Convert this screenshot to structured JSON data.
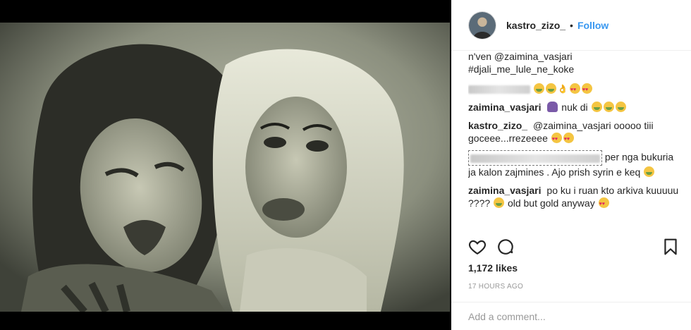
{
  "post": {
    "username": "kastro_zizo_",
    "separator": "•",
    "follow_label": "Follow",
    "caption_lines": [
      "n'ven @zaimina_vasjari",
      "#djali_me_lule_ne_koke"
    ],
    "comments": [
      {
        "user": "zaimina_vasjari",
        "text": "nuk di"
      },
      {
        "user": "kastro_zizo_",
        "text": "@zaimina_vasjari ooooo tiii goceee...rrezeeee"
      },
      {
        "text_lines": [
          "per nga",
          "bukuria ja kalon zajmines . Ajo prish syrin e",
          "keq"
        ]
      },
      {
        "user": "zaimina_vasjari",
        "text_lines": [
          "po ku i ruan kto arkiva",
          "kuuuuu ????",
          "old but gold anyway"
        ]
      }
    ],
    "likes": "1,172 likes",
    "time": "17 HOURS AGO",
    "add_comment_placeholder": "Add a comment..."
  },
  "icons": {
    "like": "heart-icon",
    "comment": "comment-bubble-icon",
    "save": "bookmark-icon"
  },
  "colors": {
    "accent": "#3897f0",
    "text": "#262626",
    "muted": "#999999"
  }
}
